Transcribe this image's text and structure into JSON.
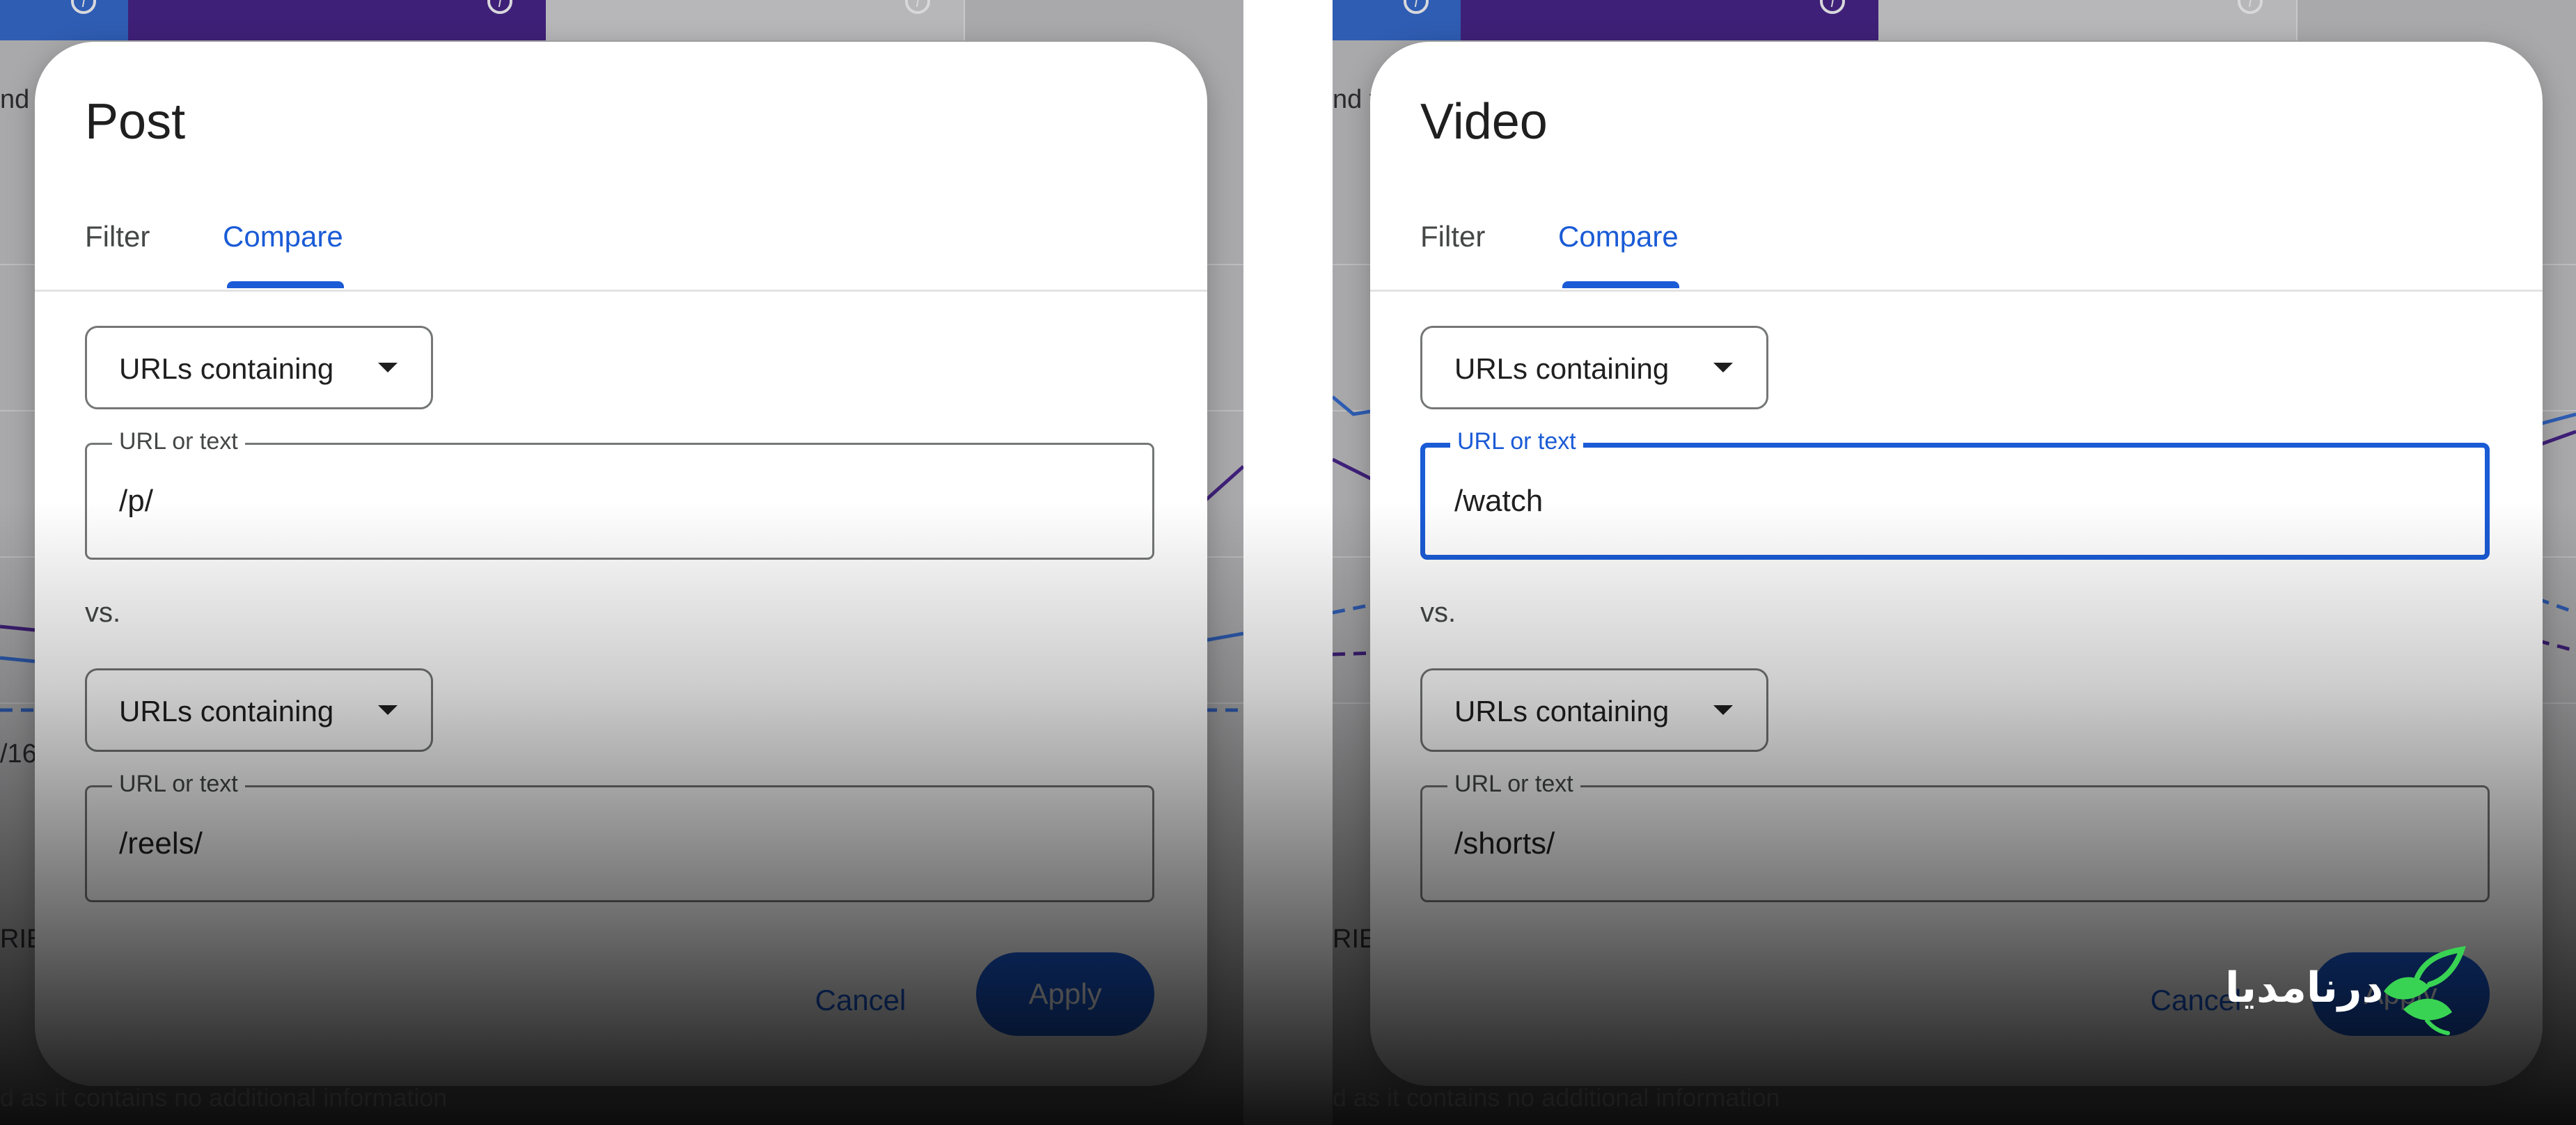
{
  "left": {
    "title": "Post",
    "tabs": {
      "filter": "Filter",
      "compare": "Compare"
    },
    "first": {
      "select": "URLs containing",
      "field_label": "URL or text",
      "field_value": "/p/"
    },
    "vs": "vs.",
    "second": {
      "select": "URLs containing",
      "field_label": "URL or text",
      "field_value": "/reels/"
    },
    "actions": {
      "cancel": "Cancel",
      "apply": "Apply"
    },
    "background": {
      "side_text_1": "nd t",
      "side_text_2": "/16",
      "side_text_3": "RIES",
      "footer": "d as it contains no additional information"
    }
  },
  "right": {
    "title": "Video",
    "tabs": {
      "filter": "Filter",
      "compare": "Compare"
    },
    "first": {
      "select": "URLs containing",
      "field_label": "URL or text",
      "field_value": "/watch"
    },
    "vs": "vs.",
    "second": {
      "select": "URLs containing",
      "field_label": "URL or text",
      "field_value": "/shorts/"
    },
    "actions": {
      "cancel": "Cancel",
      "apply": "Apply"
    },
    "background": {
      "side_text_1": "nd t",
      "side_text_3": "RIES",
      "footer": "d as it contains no additional information"
    }
  },
  "watermark": {
    "text": "درنامدیا",
    "logo_icon": "leaf-bird-logo-icon"
  },
  "colors": {
    "accent": "#1a5bd6",
    "tab_blue": "#2f5db3",
    "tab_purple": "#3f2078",
    "watermark_green": "#39d353"
  }
}
